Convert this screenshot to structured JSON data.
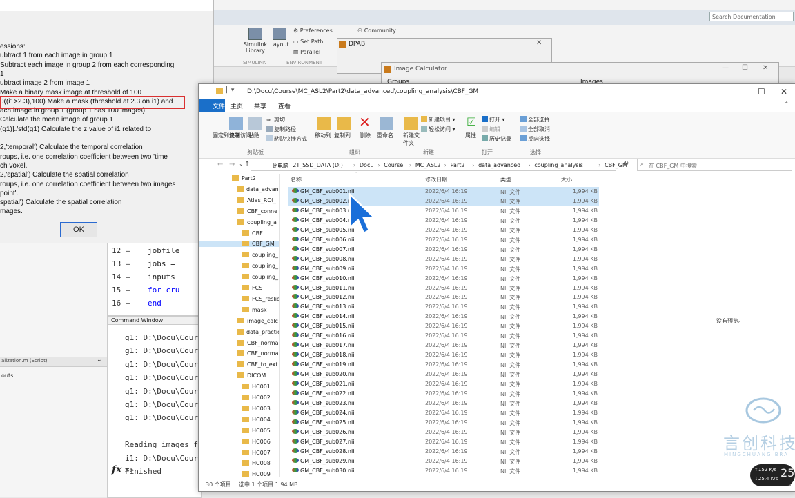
{
  "matlab": {
    "search_placeholder": "Search Documentation",
    "toolstrip": {
      "simulink": "Simulink Library",
      "layout": "Layout",
      "preferences": "Preferences",
      "set_path": "Set Path",
      "parallel": "Parallel",
      "community": "Community",
      "group_simulink": "SIMULINK",
      "group_environment": "ENVIRONMENT"
    },
    "editor_lines": [
      {
        "num": "12",
        "code": "jobfile"
      },
      {
        "num": "13",
        "code": "jobs = "
      },
      {
        "num": "14",
        "code": "inputs "
      },
      {
        "num": "15",
        "code": "for cru"
      },
      {
        "num": "16",
        "code": "end"
      }
    ],
    "command_window": {
      "title": "Command Window",
      "lines": [
        "g1: D:\\Docu\\Cour",
        "g1: D:\\Docu\\Cour",
        "g1: D:\\Docu\\Cour",
        "g1: D:\\Docu\\Cour",
        "g1: D:\\Docu\\Cour",
        "g1: D:\\Docu\\Cour",
        "g1: D:\\Docu\\Cour",
        "",
        "Reading images f",
        "i1: D:\\Docu\\Cour",
        "Finished"
      ],
      "prompt": ">>",
      "fx": "fx"
    },
    "left_panel": {
      "script_name": "alization.m  (Script)",
      "outputs": "outs"
    }
  },
  "help_dialog": {
    "lines": [
      "essions:",
      "ubtract 1 from each image in group 1",
      "Subtract each image in group 2 from each corresponding",
      "1",
      "ubtract image 2 from image 1",
      "  Make a binary mask image at threshold of 100",
      "0((i1>2.3),100) Make a mask (threshold at 2.3 on i1) and",
      "ach image in group 1 (group 1 has 100 images)",
      "  Calculate the mean image of group 1",
      "(g1)]./std(g1)   Calculate the z value of i1 related to",
      "",
      "2,'temporal')   Calculate the temporal correlation",
      "roups, i.e. one correlation coefficient between two 'time",
      "ch voxel.",
      "2,'spatial')    Calculate the spatial correlation",
      "roups, i.e. one correlation coefficient between two images",
      "point'.",
      "spatial')    Calculate the spatial correlation",
      "mages."
    ],
    "ok_label": "OK"
  },
  "dpabi": {
    "title": "DPABI"
  },
  "image_calculator": {
    "title": "Image Calculator",
    "groups_label": "Groups",
    "images_label": "Images"
  },
  "explorer": {
    "title_path": "D:\\Docu\\Course\\MC_ASL2\\Part2\\data_advanced\\coupling_analysis\\CBF_GM",
    "tabs": {
      "file": "文件",
      "home": "主页",
      "share": "共享",
      "view": "查看"
    },
    "ribbon": {
      "pin": "固定到快速访问",
      "copy": "复制",
      "paste": "粘贴",
      "cut": "剪切",
      "copy_path": "复制路径",
      "paste_shortcut": "粘贴快捷方式",
      "move_to": "移动到",
      "copy_to": "复制到",
      "delete": "删除",
      "rename": "重命名",
      "new_folder": "新建文件夹",
      "new_item": "新建项目",
      "easy_access": "轻松访问",
      "properties": "属性",
      "open": "打开",
      "edit": "编辑",
      "history": "历史记录",
      "select_all": "全部选择",
      "select_none": "全部取消",
      "invert": "反向选择",
      "group_clipboard": "剪贴板",
      "group_organize": "组织",
      "group_new": "新建",
      "group_open": "打开",
      "group_select": "选择"
    },
    "breadcrumbs": [
      "此电脑",
      "2T_SSD_DATA (D:)",
      "Docu",
      "Course",
      "MC_ASL2",
      "Part2",
      "data_advanced",
      "coupling_analysis",
      "CBF_GM"
    ],
    "search_placeholder": "在 CBF_GM 中搜索",
    "nav_items": [
      {
        "label": "Part2",
        "indent": 0
      },
      {
        "label": "data_advanc",
        "indent": 1
      },
      {
        "label": "Atlas_ROI_",
        "indent": 2
      },
      {
        "label": "CBF_conne",
        "indent": 2
      },
      {
        "label": "coupling_a",
        "indent": 2
      },
      {
        "label": "CBF",
        "indent": 3
      },
      {
        "label": "CBF_GM",
        "indent": 3,
        "selected": true
      },
      {
        "label": "coupling_",
        "indent": 3
      },
      {
        "label": "coupling_",
        "indent": 3
      },
      {
        "label": "coupling_",
        "indent": 3
      },
      {
        "label": "FCS",
        "indent": 3
      },
      {
        "label": "FCS_reslic",
        "indent": 3
      },
      {
        "label": "mask",
        "indent": 3
      },
      {
        "label": "image_calc",
        "indent": 2
      },
      {
        "label": "data_practic",
        "indent": 1
      },
      {
        "label": "CBF_norma",
        "indent": 2
      },
      {
        "label": "CBF_norma",
        "indent": 2
      },
      {
        "label": "CBF_to_ext",
        "indent": 2
      },
      {
        "label": "DICOM",
        "indent": 2
      },
      {
        "label": "HC001",
        "indent": 3
      },
      {
        "label": "HC002",
        "indent": 3
      },
      {
        "label": "HC003",
        "indent": 3
      },
      {
        "label": "HC004",
        "indent": 3
      },
      {
        "label": "HC005",
        "indent": 3
      },
      {
        "label": "HC006",
        "indent": 3
      },
      {
        "label": "HC007",
        "indent": 3
      },
      {
        "label": "HC008",
        "indent": 3
      },
      {
        "label": "HC009",
        "indent": 3
      }
    ],
    "columns": {
      "name": "名称",
      "date": "修改日期",
      "type": "类型",
      "size": "大小"
    },
    "file_date": "2022/6/4 16:19",
    "file_type": "NII 文件",
    "file_size": "1,994 KB",
    "files": [
      "GM_CBF_sub001.nii",
      "GM_CBF_sub002.nii",
      "GM_CBF_sub003.nii",
      "GM_CBF_sub004.nii",
      "GM_CBF_sub005.nii",
      "GM_CBF_sub006.nii",
      "GM_CBF_sub007.nii",
      "GM_CBF_sub008.nii",
      "GM_CBF_sub009.nii",
      "GM_CBF_sub010.nii",
      "GM_CBF_sub011.nii",
      "GM_CBF_sub012.nii",
      "GM_CBF_sub013.nii",
      "GM_CBF_sub014.nii",
      "GM_CBF_sub015.nii",
      "GM_CBF_sub016.nii",
      "GM_CBF_sub017.nii",
      "GM_CBF_sub018.nii",
      "GM_CBF_sub019.nii",
      "GM_CBF_sub020.nii",
      "GM_CBF_sub021.nii",
      "GM_CBF_sub022.nii",
      "GM_CBF_sub023.nii",
      "GM_CBF_sub024.nii",
      "GM_CBF_sub025.nii",
      "GM_CBF_sub026.nii",
      "GM_CBF_sub027.nii",
      "GM_CBF_sub028.nii",
      "GM_CBF_sub029.nii",
      "GM_CBF_sub030.nii"
    ],
    "selected_indices": [
      0,
      1
    ],
    "preview_text": "没有预览。",
    "status_count": "30 个项目",
    "status_selected": "选中 1 个项目  1.94 MB"
  },
  "watermark": {
    "text": "言创科技",
    "subtext": "MINGCHUANG BRA"
  },
  "net_meter": {
    "up": "152",
    "down": "25.4",
    "unit": "K/s",
    "badge": "25"
  },
  "colors": {
    "accent": "#1a6fc9",
    "selection": "#cce4f7",
    "folder": "#e9b949",
    "highlight_box": "#d93030"
  }
}
